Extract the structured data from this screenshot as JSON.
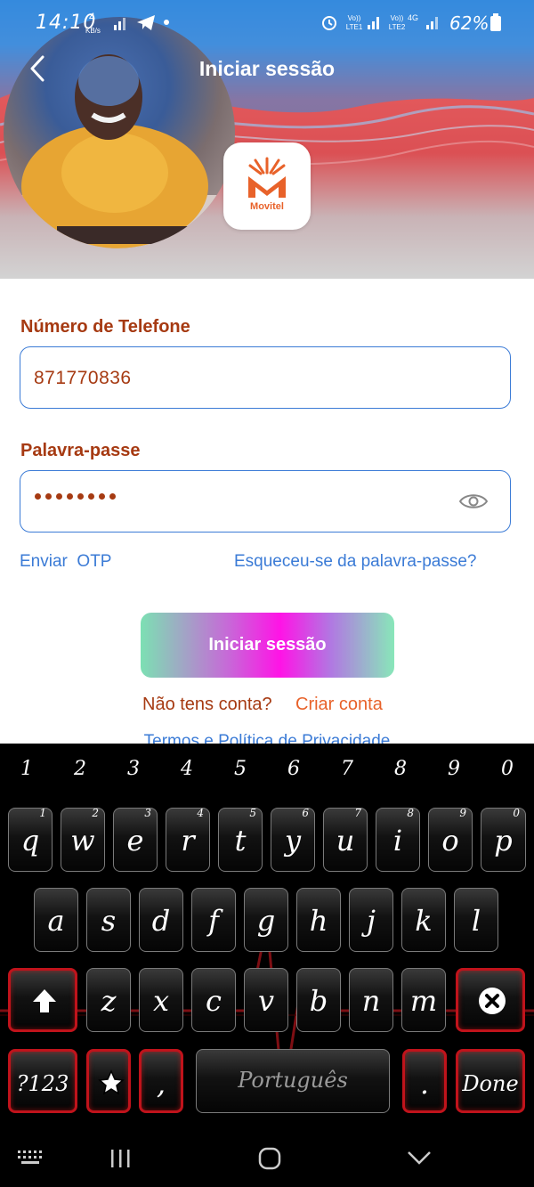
{
  "status": {
    "time": "14:10",
    "speed_value": "4",
    "speed_unit": "KB/s",
    "sim1": "Vo)) LTE1",
    "sim2": "Vo)) LTE2",
    "net": "4G",
    "battery": "62%"
  },
  "header": {
    "title": "Iniciar sessão"
  },
  "logo": {
    "text": "Movitel"
  },
  "form": {
    "phone_label": "Número de Telefone",
    "phone_value": "871770836",
    "password_label": "Palavra-passe",
    "password_length": 8
  },
  "links": {
    "otp": "Enviar  OTP",
    "forgot": "Esqueceu-se da palavra-passe?"
  },
  "login_button": "Iniciar sessão",
  "signup": {
    "question": "Não tens conta?",
    "action": "Criar conta"
  },
  "terms": "Termos e Política de Privacidade",
  "keyboard": {
    "numbers": [
      "1",
      "2",
      "3",
      "4",
      "5",
      "6",
      "7",
      "8",
      "9",
      "0"
    ],
    "row1": [
      "q",
      "w",
      "e",
      "r",
      "t",
      "y",
      "u",
      "i",
      "o",
      "p"
    ],
    "row1_sup": [
      "1",
      "2",
      "3",
      "4",
      "5",
      "6",
      "7",
      "8",
      "9",
      "0"
    ],
    "row2": [
      "a",
      "s",
      "d",
      "f",
      "g",
      "h",
      "j",
      "k",
      "l"
    ],
    "row3": [
      "z",
      "x",
      "c",
      "v",
      "b",
      "n",
      "m"
    ],
    "symbols_key": "?123",
    "comma": ",",
    "space_label": "Português",
    "period": ".",
    "done": "Done"
  },
  "colors": {
    "label": "#a63a12",
    "link": "#3b7bd6",
    "signup_action": "#e8622a",
    "key_border_red": "#c0131b"
  }
}
